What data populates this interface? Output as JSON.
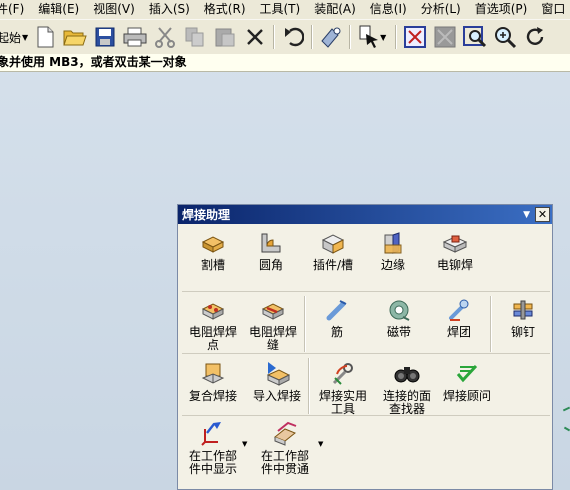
{
  "menubar": {
    "items": [
      "件(F)",
      "编辑(E)",
      "视图(V)",
      "插入(S)",
      "格式(R)",
      "工具(T)",
      "装配(A)",
      "信息(I)",
      "分析(L)",
      "首选项(P)",
      "窗口"
    ]
  },
  "toolbar": {
    "start_label": "起始",
    "icons": [
      "new-file-icon",
      "open-folder-icon",
      "save-icon",
      "print-icon",
      "cut-icon",
      "copy-icon",
      "paste-icon",
      "delete-icon",
      "undo-icon",
      "command-finder-icon",
      "selection-filter-icon",
      "fit-icon",
      "refresh-icon",
      "zoom-area-icon",
      "zoom-icon",
      "rotate-icon"
    ]
  },
  "status": {
    "message": "象并使用 MB3，或者双击某一对象"
  },
  "panel": {
    "title": "焊接助理",
    "row1": [
      {
        "label": "割槽",
        "icon": "groove-icon"
      },
      {
        "label": "圆角",
        "icon": "fillet-icon"
      },
      {
        "label": "插件/槽",
        "icon": "insert-slot-icon"
      },
      {
        "label": "边缘",
        "icon": "edge-icon"
      },
      {
        "label": "电铆焊",
        "icon": "rivet-weld-icon"
      }
    ],
    "row2": [
      {
        "label": "电阻焊焊\n点",
        "icon": "resistance-spot-icon"
      },
      {
        "label": "电阻焊焊\n缝",
        "icon": "resistance-seam-icon"
      },
      {
        "label": "筋",
        "icon": "rib-icon"
      },
      {
        "label": "磁带",
        "icon": "tape-icon"
      },
      {
        "label": "焊团",
        "icon": "weld-blob-icon"
      },
      {
        "label": "铆钉",
        "icon": "rivet-icon"
      }
    ],
    "row3": [
      {
        "label": "复合焊接",
        "icon": "combined-weld-icon"
      },
      {
        "label": "导入焊接",
        "icon": "import-weld-icon"
      },
      {
        "label": "焊接实用\n工具",
        "icon": "weld-utilities-icon"
      },
      {
        "label": "连接的面\n查找器",
        "icon": "binoculars-icon"
      },
      {
        "label": "焊接顾问",
        "icon": "weld-advisor-icon"
      }
    ],
    "row4": [
      {
        "label": "在工作部\n件中显示",
        "icon": "show-in-work-part-icon"
      },
      {
        "label": "在工作部\n件中贯通",
        "icon": "through-work-part-icon"
      }
    ]
  },
  "colors": {
    "title_bar": "#0a246a",
    "toolbar_bg": "#ece9d8",
    "canvas_bg": "#d6e1ec",
    "status_bg": "#fffff0"
  }
}
